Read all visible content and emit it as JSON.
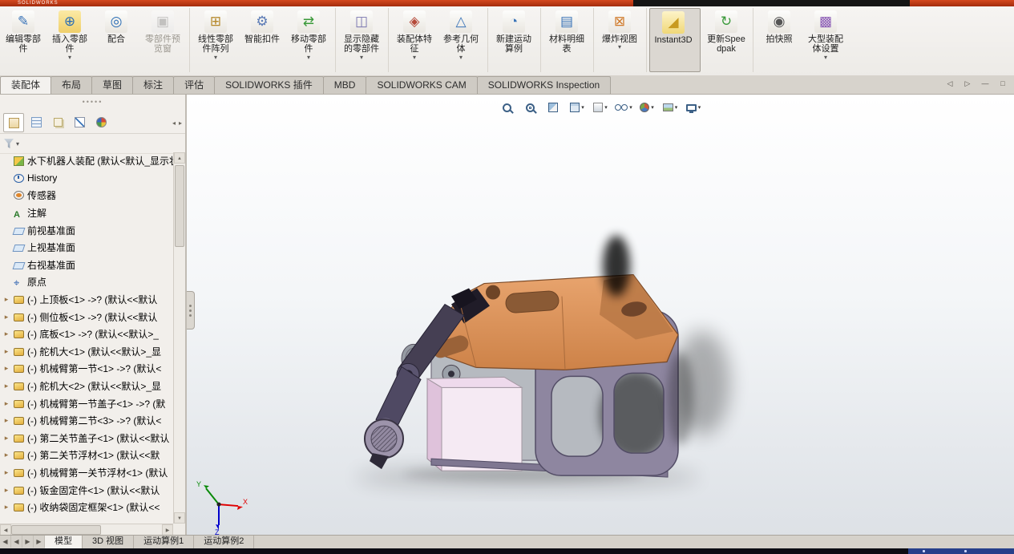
{
  "window": {
    "brand": "SOLIDWORKS"
  },
  "colors": {
    "accent_red": "#c23a17",
    "ribbon_bg": "#f1efec",
    "selected_button_bg": "#dbd7d1",
    "viewport_top": "#ffffff",
    "viewport_bottom": "#dde1e6",
    "model_orange": "#e0945f",
    "model_purple": "#8e86a0",
    "model_pink": "#f5eaf3",
    "model_dark": "#3a3444",
    "triad_x_color": "#e00000",
    "triad_y_color": "#0a8a0a",
    "triad_z_color": "#0000cc"
  },
  "ribbon": {
    "buttons": [
      {
        "label": "编辑零部件",
        "icon": "edit-component",
        "caret": "",
        "state": "normal",
        "sep": ""
      },
      {
        "label": "插入零部件",
        "icon": "insert-component",
        "caret": "▾",
        "state": "normal",
        "sep": ""
      },
      {
        "label": "配合",
        "icon": "mate",
        "caret": "",
        "state": "normal",
        "sep": ""
      },
      {
        "label": "零部件预览窗",
        "icon": "component-preview",
        "caret": "",
        "state": "disabled",
        "sep": "y"
      },
      {
        "label": "线性零部件阵列",
        "icon": "linear-pattern",
        "caret": "▾",
        "state": "normal",
        "sep": ""
      },
      {
        "label": "智能扣件",
        "icon": "smart-fasteners",
        "caret": "",
        "state": "normal",
        "sep": ""
      },
      {
        "label": "移动零部件",
        "icon": "move-component",
        "caret": "▾",
        "state": "normal",
        "sep": "y"
      },
      {
        "label": "显示隐藏的零部件",
        "icon": "show-hidden-components",
        "caret": "▾",
        "state": "normal",
        "sep": "y"
      },
      {
        "label": "装配体特征",
        "icon": "assembly-features",
        "caret": "▾",
        "state": "normal",
        "sep": ""
      },
      {
        "label": "参考几何体",
        "icon": "reference-geometry",
        "caret": "▾",
        "state": "normal",
        "sep": "y"
      },
      {
        "label": "新建运动算例",
        "icon": "new-motion-study",
        "caret": "",
        "state": "normal",
        "sep": "y"
      },
      {
        "label": "材料明细表",
        "icon": "bill-of-materials",
        "caret": "",
        "state": "normal",
        "sep": "y"
      },
      {
        "label": "爆炸视图",
        "icon": "exploded-view",
        "caret": "▾",
        "state": "normal",
        "sep": "y"
      },
      {
        "label": "Instant3D",
        "icon": "instant3d",
        "caret": "",
        "state": "selected",
        "sep": "y"
      },
      {
        "label": "更新Speedpak",
        "icon": "update-speedpak",
        "caret": "",
        "state": "normal",
        "sep": "y"
      },
      {
        "label": "拍快照",
        "icon": "take-snapshot",
        "caret": "",
        "state": "normal",
        "sep": ""
      },
      {
        "label": "大型装配体设置",
        "icon": "large-assembly-settings",
        "caret": "▾",
        "state": "normal",
        "sep": ""
      }
    ]
  },
  "ribbon_tabs": {
    "items": [
      {
        "label": "装配体",
        "state": "active"
      },
      {
        "label": "布局",
        "state": ""
      },
      {
        "label": "草图",
        "state": ""
      },
      {
        "label": "标注",
        "state": ""
      },
      {
        "label": "评估",
        "state": ""
      },
      {
        "label": "SOLIDWORKS 插件",
        "state": ""
      },
      {
        "label": "MBD",
        "state": ""
      },
      {
        "label": "SOLIDWORKS CAM",
        "state": ""
      },
      {
        "label": "SOLIDWORKS Inspection",
        "state": ""
      }
    ]
  },
  "window_controls": [
    "◁",
    "▷",
    "—",
    "□"
  ],
  "left_panel": {
    "tabs": [
      {
        "icon": "feature-manager",
        "state": "active"
      },
      {
        "icon": "property-manager",
        "state": ""
      },
      {
        "icon": "configuration-manager",
        "state": ""
      },
      {
        "icon": "dimxpert-manager",
        "state": ""
      },
      {
        "icon": "display-manager",
        "state": ""
      }
    ],
    "tab_arrows": [
      "◂",
      "▸"
    ]
  },
  "feature_tree": {
    "items": [
      {
        "caret": "",
        "icon": "assembly",
        "label": "水下机器人装配 (默认<默认_显示状"
      },
      {
        "caret": "",
        "icon": "history",
        "label": "History"
      },
      {
        "caret": "",
        "icon": "sensor",
        "label": "传感器"
      },
      {
        "caret": "",
        "icon": "annotation",
        "label": "注解"
      },
      {
        "caret": "",
        "icon": "plane",
        "label": "前视基准面"
      },
      {
        "caret": "",
        "icon": "plane",
        "label": "上视基准面"
      },
      {
        "caret": "",
        "icon": "plane",
        "label": "右视基准面"
      },
      {
        "caret": "",
        "icon": "origin",
        "label": "原点"
      },
      {
        "caret": "▸",
        "icon": "part",
        "label": "(-) 上顶板<1> ->? (默认<<默认"
      },
      {
        "caret": "▸",
        "icon": "part",
        "label": "(-) 侧位板<1> ->? (默认<<默认"
      },
      {
        "caret": "▸",
        "icon": "part",
        "label": "(-) 底板<1> ->? (默认<<默认>_"
      },
      {
        "caret": "▸",
        "icon": "part",
        "label": "(-) 舵机大<1> (默认<<默认>_显"
      },
      {
        "caret": "▸",
        "icon": "part",
        "label": "(-) 机械臂第一节<1> ->? (默认<"
      },
      {
        "caret": "▸",
        "icon": "part",
        "label": "(-) 舵机大<2> (默认<<默认>_显"
      },
      {
        "caret": "▸",
        "icon": "part",
        "label": "(-) 机械臂第一节盖子<1> ->? (默"
      },
      {
        "caret": "▸",
        "icon": "part",
        "label": "(-) 机械臂第二节<3> ->? (默认<"
      },
      {
        "caret": "▸",
        "icon": "part",
        "label": "(-) 第二关节盖子<1> (默认<<默认"
      },
      {
        "caret": "▸",
        "icon": "part",
        "label": "(-) 第二关节浮材<1> (默认<<默"
      },
      {
        "caret": "▸",
        "icon": "part",
        "label": "(-) 机械臂第一关节浮材<1> (默认"
      },
      {
        "caret": "▸",
        "icon": "part",
        "label": "(-) 钣金固定件<1> (默认<<默认"
      },
      {
        "caret": "▸",
        "icon": "part",
        "label": "(-) 收纳袋固定框架<1> (默认<<"
      }
    ]
  },
  "headsup": {
    "items": [
      {
        "name": "zoom-fit",
        "caret": ""
      },
      {
        "name": "zoom-area",
        "caret": ""
      },
      {
        "name": "section-view",
        "caret": ""
      },
      {
        "name": "view-orientation",
        "caret": "▾"
      },
      {
        "name": "display-style",
        "caret": "▾"
      },
      {
        "name": "hide-show-items",
        "caret": "▾"
      },
      {
        "name": "edit-appearance",
        "caret": "▾"
      },
      {
        "name": "apply-scene",
        "caret": "▾"
      },
      {
        "name": "view-settings",
        "caret": "▾"
      }
    ]
  },
  "triad": {
    "x": "X",
    "y": "Y",
    "z": "Z"
  },
  "bottom_tabs": {
    "nav": [
      "◀",
      "◀",
      "▶",
      "▶"
    ],
    "items": [
      {
        "label": "模型",
        "state": "active"
      },
      {
        "label": "3D 视图",
        "state": ""
      },
      {
        "label": "运动算例1",
        "state": ""
      },
      {
        "label": "运动算例2",
        "state": ""
      }
    ]
  }
}
